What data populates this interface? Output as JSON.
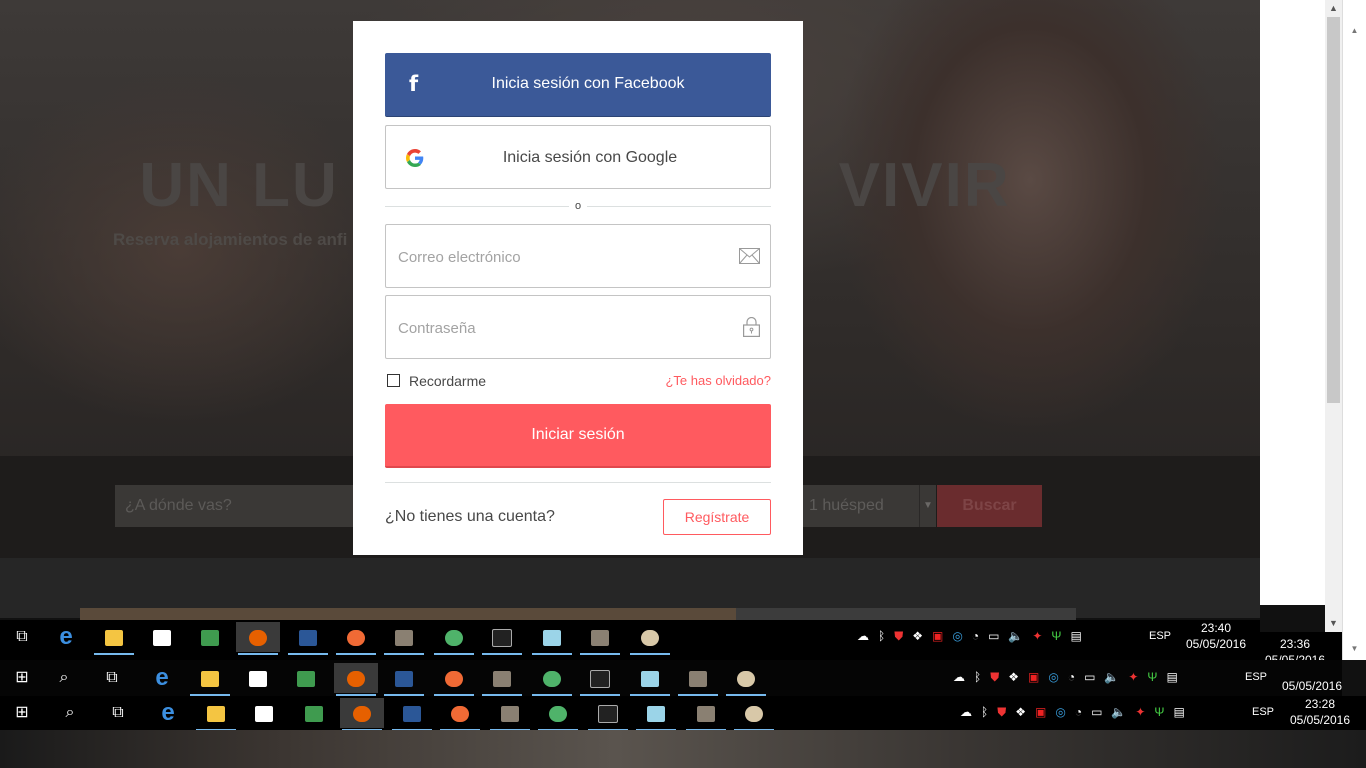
{
  "background": {
    "hero_title": "UN LU                          VIVIR",
    "hero_subtitle": "Reserva alojamientos de anfi                                                                      udad como un habitante más.",
    "search_placeholder": "¿A dónde vas?",
    "guests": "1 huésped",
    "search_button": "Buscar"
  },
  "modal": {
    "facebook_label": "Inicia sesión con Facebook",
    "facebook_icon": "f",
    "google_label": "Inicia sesión con Google",
    "divider_text": "o",
    "email_placeholder": "Correo electrónico",
    "password_placeholder": "Contraseña",
    "remember_label": "Recordarme",
    "forgot_label": "¿Te has olvidado?",
    "login_button": "Iniciar sesión",
    "no_account_text": "¿No tienes una cuenta?",
    "register_button": "Regístrate"
  },
  "taskbar_top": {
    "lang": "ESP",
    "time": "23:40",
    "date": "05/05/2016"
  },
  "taskbar_middle": {
    "lang": "ESP",
    "time": "23:36",
    "date": "05/05/2016",
    "clock2_date": "05/05/2016"
  },
  "taskbar_bottom": {
    "lang": "ESP",
    "time": "23:28",
    "date": "05/05/2016"
  },
  "colors": {
    "facebook": "#3b5998",
    "brand": "#ff5a5f"
  }
}
